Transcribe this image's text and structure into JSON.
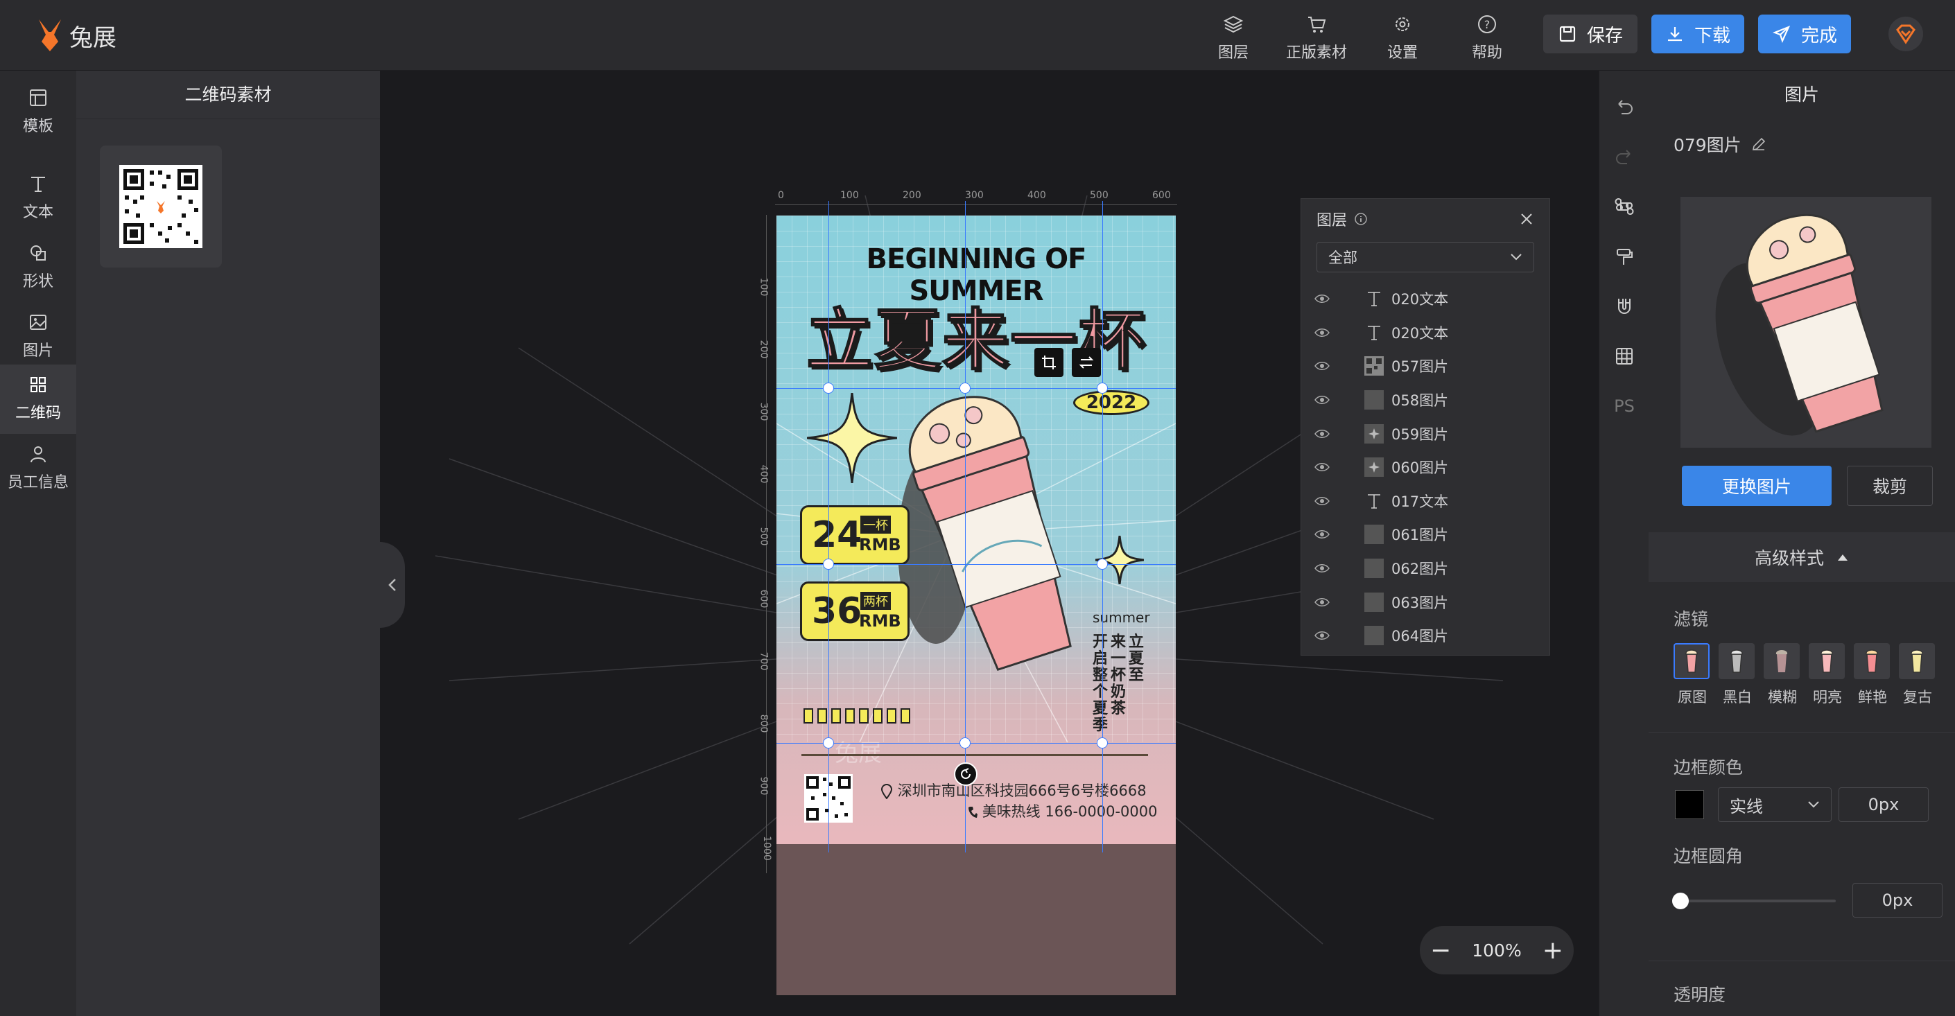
{
  "app": {
    "name": "兔展"
  },
  "toolbar": {
    "layers": "图层",
    "assets": "正版素材",
    "settings": "设置",
    "help": "帮助",
    "save": "保存",
    "download": "下载",
    "finish": "完成"
  },
  "sidebar": {
    "items": [
      {
        "label": "模板"
      },
      {
        "label": "文本"
      },
      {
        "label": "形状"
      },
      {
        "label": "图片"
      },
      {
        "label": "二维码"
      },
      {
        "label": "员工信息"
      }
    ]
  },
  "panel": {
    "title": "二维码素材"
  },
  "poster": {
    "title_en": "BEGINNING OF SUMMER",
    "title_cn": "立夏来一杯",
    "year": "2022",
    "price1": {
      "num": "24",
      "tag": "一杯",
      "unit": "RMB"
    },
    "price2": {
      "num": "36",
      "tag": "两杯",
      "unit": "RMB"
    },
    "summer": "summer",
    "vert_col1": "开启整个夏季",
    "vert_col2": "来一杯奶茶",
    "vert_col3": "立夏至",
    "address": "深圳市南山区科技园666号6号楼6668",
    "phone": "美味热线 166-0000-0000",
    "watermark": "兔展"
  },
  "ruler": {
    "top": [
      "0",
      "100",
      "200",
      "300",
      "400",
      "500",
      "600"
    ],
    "left": [
      "100",
      "200",
      "300",
      "400",
      "500",
      "600",
      "700",
      "800",
      "900",
      "1000"
    ]
  },
  "layers_panel": {
    "title": "图层",
    "filter": "全部",
    "items": [
      {
        "name": "020文本",
        "kind": "text"
      },
      {
        "name": "020文本",
        "kind": "text"
      },
      {
        "name": "057图片",
        "kind": "image"
      },
      {
        "name": "058图片",
        "kind": "image"
      },
      {
        "name": "059图片",
        "kind": "image"
      },
      {
        "name": "060图片",
        "kind": "image"
      },
      {
        "name": "017文本",
        "kind": "text"
      },
      {
        "name": "061图片",
        "kind": "image"
      },
      {
        "name": "062图片",
        "kind": "image"
      },
      {
        "name": "063图片",
        "kind": "image"
      },
      {
        "name": "064图片",
        "kind": "image"
      }
    ]
  },
  "zoom": {
    "value": "100%"
  },
  "toolstrip": {
    "ps": "PS"
  },
  "right_panel": {
    "title": "图片",
    "name": "079图片",
    "replace": "更换图片",
    "crop": "裁剪",
    "advanced": "高级样式",
    "filter_label": "滤镜",
    "filters": [
      "原图",
      "黑白",
      "模糊",
      "明亮",
      "鲜艳",
      "复古"
    ],
    "border_color_label": "边框颜色",
    "border_style": "实线",
    "border_width": "0px",
    "radius_label": "边框圆角",
    "radius_value": "0px",
    "opacity_label": "透明度"
  },
  "colors": {
    "accent": "#3a7bff",
    "brand": "#f5762a",
    "poster_pink": "#f09aa2",
    "poster_yellow": "#f4ea5a"
  }
}
